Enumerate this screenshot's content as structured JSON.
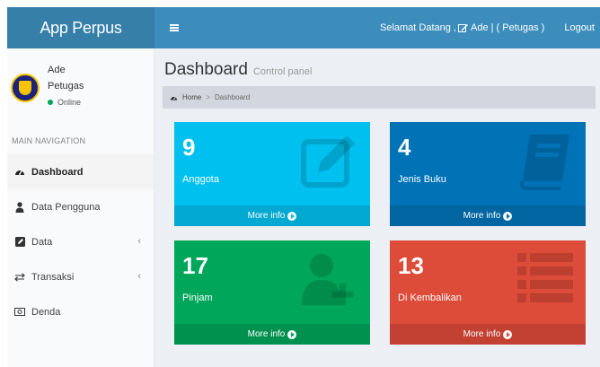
{
  "header": {
    "brand": "App Perpus",
    "welcome_prefix": "Selamat Datang ,",
    "user_link": "Ade | ( Petugas )",
    "logout": "Logout"
  },
  "sidebar": {
    "user_name": "Ade",
    "user_role": "Petugas",
    "status": "Online",
    "nav_header": "MAIN NAVIGATION",
    "items": [
      {
        "label": "Dashboard",
        "icon": "dashboard-icon"
      },
      {
        "label": "Data Pengguna",
        "icon": "user-icon"
      },
      {
        "label": "Data",
        "icon": "edit-icon"
      },
      {
        "label": "Transaksi",
        "icon": "exchange-icon"
      },
      {
        "label": "Denda",
        "icon": "money-icon"
      }
    ]
  },
  "main": {
    "title": "Dashboard",
    "subtitle": "Control panel",
    "breadcrumb": [
      "Home",
      "Dashboard"
    ],
    "boxes": [
      {
        "value": "9",
        "label": "Anggota",
        "link": "More info",
        "color": "#00c0ef",
        "icon": "edit-icon"
      },
      {
        "value": "4",
        "label": "Jenis Buku",
        "link": "More info",
        "color": "#0073b7",
        "icon": "book-icon"
      },
      {
        "value": "17",
        "label": "Pinjam",
        "link": "More info",
        "color": "#00a65a",
        "icon": "user-plus-icon"
      },
      {
        "value": "13",
        "label": "Di Kembalikan",
        "link": "More info",
        "color": "#dd4b39",
        "icon": "list-icon"
      }
    ]
  },
  "colors": {
    "header_blue": "#3c8dbc",
    "brand_blue": "#367fa9",
    "online_green": "#00a65a"
  }
}
